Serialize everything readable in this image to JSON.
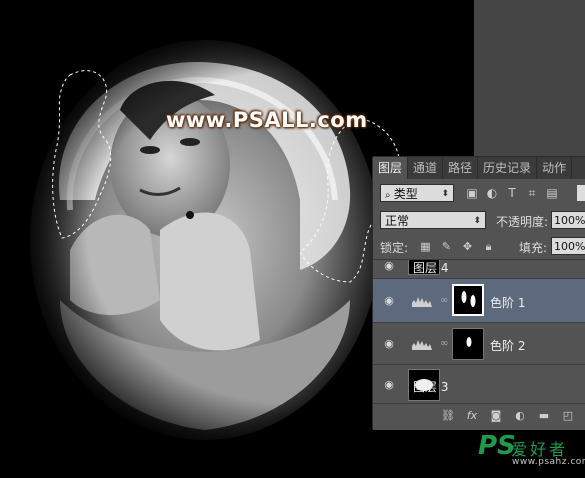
{
  "watermark": "www.PSALL.com",
  "layers_panel": {
    "tabs": [
      {
        "label": "图层",
        "active": true
      },
      {
        "label": "通道",
        "active": false
      },
      {
        "label": "路径",
        "active": false
      },
      {
        "label": "历史记录",
        "active": false
      },
      {
        "label": "动作",
        "active": false
      }
    ],
    "filter_kind": "类型",
    "blend_mode": "正常",
    "opacity_label": "不透明度:",
    "opacity_value": "100%",
    "lock_label": "锁定:",
    "fill_label": "填充:",
    "fill_value": "100%",
    "layers": [
      {
        "name": "图层 4",
        "type": "pixel",
        "selected": false
      },
      {
        "name": "色阶 1",
        "type": "adjustment-levels",
        "selected": true
      },
      {
        "name": "色阶 2",
        "type": "adjustment-levels",
        "selected": false
      },
      {
        "name": "图层 3",
        "type": "pixel",
        "selected": false
      }
    ],
    "footer_icons": [
      "link-icon",
      "fx-icon",
      "add-mask-icon",
      "adjustment-icon",
      "folder-icon",
      "new-layer-icon",
      "trash-icon"
    ]
  },
  "site_logo": {
    "ps": "PS",
    "name": "爱好者",
    "url": "www.psahz.com"
  },
  "colors": {
    "panel_bg": "#535353",
    "tab_bar_bg": "#3b3b3b",
    "selected_layer_bg": "#5d6a7d",
    "logo_green": "#1f9a4c",
    "watermark_glow": "#6b3410"
  }
}
